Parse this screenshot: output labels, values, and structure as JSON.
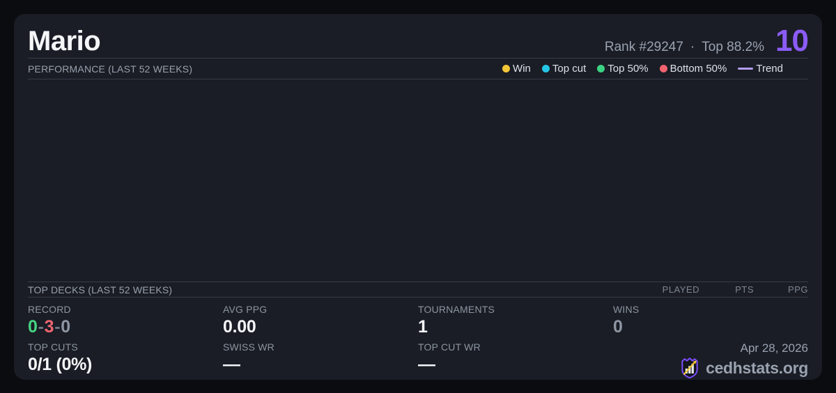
{
  "theme": {
    "page_bg": "#0b0c10",
    "card_bg": "#1a1d25",
    "divider": "#353c4a"
  },
  "header": {
    "player_name": "Mario",
    "rank": "Rank #29247",
    "dot_separator": "·",
    "top_percent": "Top 88.2%",
    "score": "10",
    "score_color": "#8b5cf6"
  },
  "performance": {
    "title": "PERFORMANCE (LAST 52 WEEKS)",
    "legend": [
      {
        "label": "Win",
        "color": "#f2c636",
        "marker": "dot"
      },
      {
        "label": "Top cut",
        "color": "#26c6e6",
        "marker": "dot"
      },
      {
        "label": "Top 50%",
        "color": "#3bd383",
        "marker": "dot"
      },
      {
        "label": "Bottom 50%",
        "color": "#f2636f",
        "marker": "dot"
      },
      {
        "label": "Trend",
        "color": "#b39df3",
        "marker": "line"
      }
    ]
  },
  "chart_data": {
    "type": "scatter",
    "title": "PERFORMANCE (LAST 52 WEEKS)",
    "x_range": "last 52 weeks",
    "legend_entries": [
      "Win",
      "Top cut",
      "Top 50%",
      "Bottom 50%",
      "Trend"
    ],
    "series": [],
    "plotted_points": 0
  },
  "top_decks": {
    "title": "TOP DECKS (LAST 52 WEEKS)",
    "columns": [
      "PLAYED",
      "PTS",
      "PPG"
    ],
    "rows": []
  },
  "stats": {
    "record_label": "RECORD",
    "record": {
      "wins": "0",
      "losses": "3",
      "draws": "0",
      "separator": "-",
      "wins_color": "#45d483",
      "losses_color": "#ee6570",
      "draws_color": "#8f96a3"
    },
    "avg_ppg_label": "AVG PPG",
    "avg_ppg": "0.00",
    "tournaments_label": "TOURNAMENTS",
    "tournaments": "1",
    "wins_label": "WINS",
    "wins": "0",
    "top_cuts_label": "TOP CUTS",
    "top_cuts": "0/1 (0%)",
    "swiss_wr_label": "SWISS WR",
    "swiss_wr": "—",
    "top_cut_wr_label": "TOP CUT WR",
    "top_cut_wr": "—"
  },
  "footer": {
    "date": "Apr 28, 2026",
    "brand": "cedhstats.org"
  }
}
